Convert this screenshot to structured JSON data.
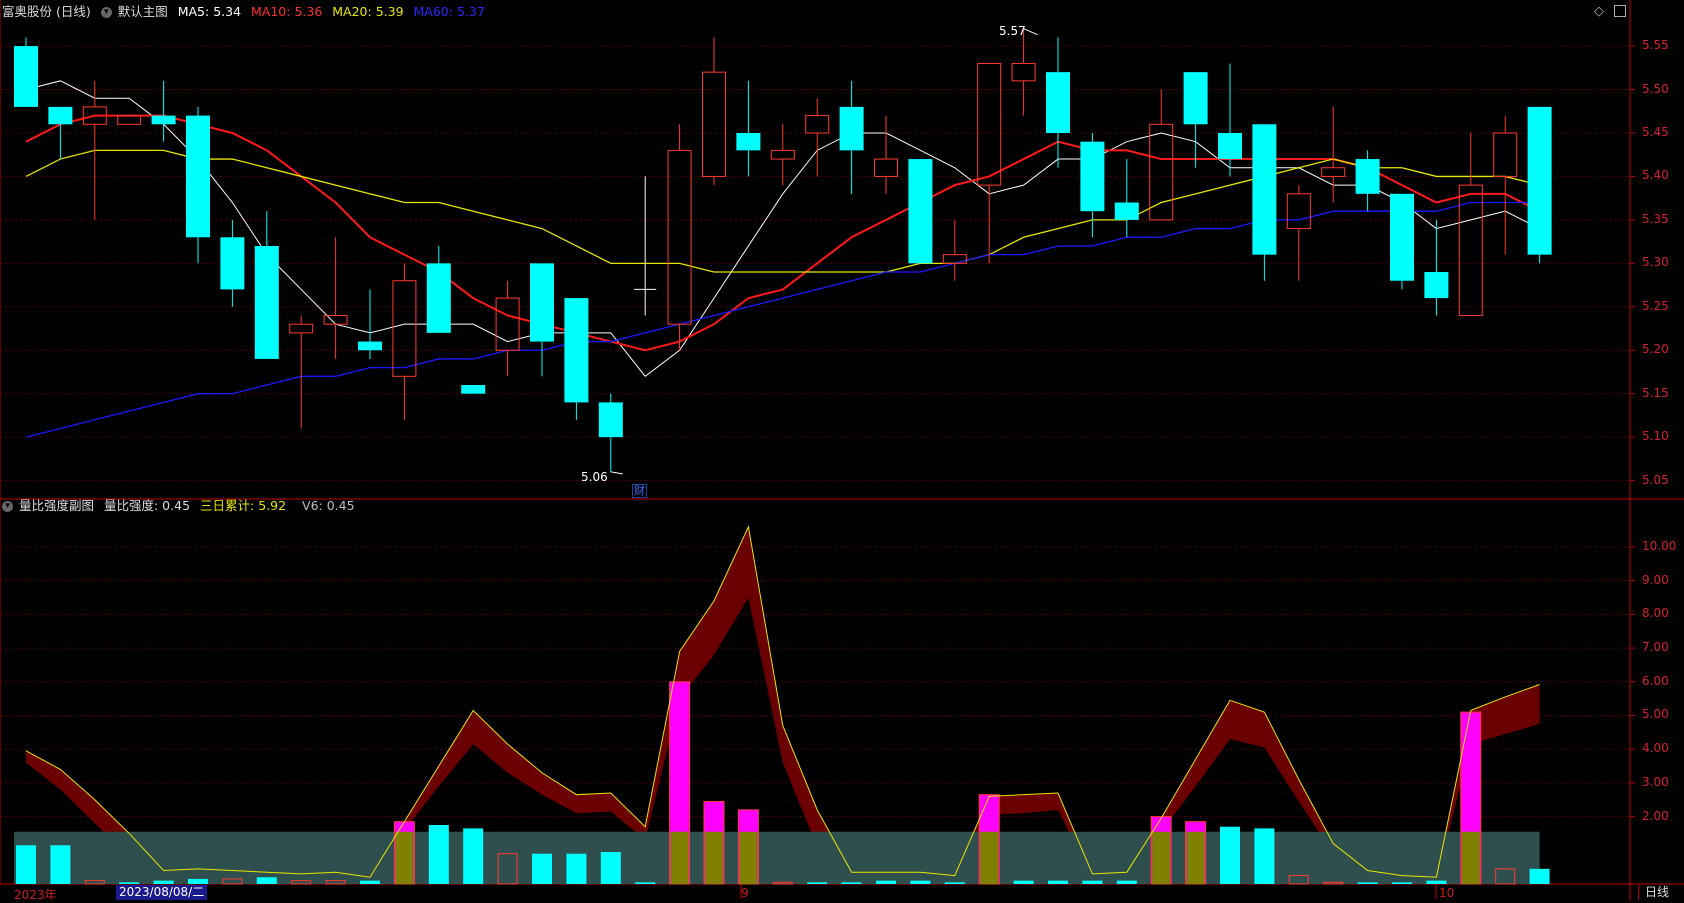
{
  "main_header": {
    "stock_name": "富奥股份 (日线)",
    "chart_name": "默认主图",
    "ma5": "MA5: 5.34",
    "ma10": "MA10: 5.36",
    "ma20": "MA20: 5.39",
    "ma60": "MA60: 5.37"
  },
  "sub_header": {
    "chart_name": "量比强度副图",
    "vr": "量比强度: 0.45",
    "sum3": "三日累计: 5.92",
    "v6": "V6: 0.45"
  },
  "icons": {
    "collapse": "chevron-down-icon",
    "restore": "diamond-icon",
    "close": "close-box-icon"
  },
  "bottom_bar": {
    "year": "2023年",
    "cursor_date": "2023/08/08/二",
    "month_9": "9",
    "month_10": "10",
    "period": "日线"
  },
  "annotations": {
    "high": "5.57",
    "low": "5.06",
    "finance_marker": "财"
  },
  "colors": {
    "up": "#ff3b30",
    "down": "#00ffff",
    "ma5": "#ffffff",
    "ma10": "#ff1a1a",
    "ma20": "#e6e600",
    "ma60": "#1a1aff",
    "axis": "#c00000",
    "band": "#2f4f4f",
    "ribbon": "#6b0000"
  },
  "chart_data": [
    {
      "type": "candlestick",
      "title": "默认主图",
      "yticks": [
        5.55,
        5.5,
        5.45,
        5.4,
        5.35,
        5.3,
        5.25,
        5.2,
        5.15,
        5.1,
        5.05
      ],
      "ylim": [
        5.03,
        5.58
      ],
      "candles": [
        {
          "o": 5.48,
          "c": 5.55,
          "h": 5.56,
          "l": 5.48,
          "d": "down"
        },
        {
          "o": 5.46,
          "c": 5.48,
          "h": 5.48,
          "l": 5.42,
          "d": "down"
        },
        {
          "o": 5.46,
          "c": 5.48,
          "h": 5.51,
          "l": 5.35,
          "d": "up"
        },
        {
          "o": 5.47,
          "c": 5.46,
          "h": 5.47,
          "l": 5.46,
          "d": "up"
        },
        {
          "o": 5.47,
          "c": 5.46,
          "h": 5.51,
          "l": 5.44,
          "d": "down"
        },
        {
          "o": 5.47,
          "c": 5.33,
          "h": 5.48,
          "l": 5.3,
          "d": "down"
        },
        {
          "o": 5.33,
          "c": 5.27,
          "h": 5.35,
          "l": 5.25,
          "d": "down"
        },
        {
          "o": 5.32,
          "c": 5.19,
          "h": 5.36,
          "l": 5.19,
          "d": "down"
        },
        {
          "o": 5.22,
          "c": 5.23,
          "h": 5.24,
          "l": 5.11,
          "d": "up"
        },
        {
          "o": 5.23,
          "c": 5.24,
          "h": 5.33,
          "l": 5.19,
          "d": "up"
        },
        {
          "o": 5.21,
          "c": 5.2,
          "h": 5.27,
          "l": 5.19,
          "d": "down"
        },
        {
          "o": 5.17,
          "c": 5.28,
          "h": 5.3,
          "l": 5.12,
          "d": "up"
        },
        {
          "o": 5.3,
          "c": 5.22,
          "h": 5.32,
          "l": 5.22,
          "d": "down"
        },
        {
          "o": 5.16,
          "c": 5.15,
          "h": 5.16,
          "l": 5.15,
          "d": "down"
        },
        {
          "o": 5.2,
          "c": 5.26,
          "h": 5.28,
          "l": 5.17,
          "d": "up"
        },
        {
          "o": 5.3,
          "c": 5.21,
          "h": 5.3,
          "l": 5.17,
          "d": "down"
        },
        {
          "o": 5.26,
          "c": 5.14,
          "h": 5.26,
          "l": 5.12,
          "d": "down"
        },
        {
          "o": 5.14,
          "c": 5.1,
          "h": 5.15,
          "l": 5.06,
          "d": "down"
        },
        {
          "o": 5.27,
          "c": 5.27,
          "h": 5.4,
          "l": 5.24,
          "d": "cross"
        },
        {
          "o": 5.23,
          "c": 5.43,
          "h": 5.46,
          "l": 5.2,
          "d": "up"
        },
        {
          "o": 5.4,
          "c": 5.52,
          "h": 5.56,
          "l": 5.39,
          "d": "up"
        },
        {
          "o": 5.45,
          "c": 5.43,
          "h": 5.51,
          "l": 5.4,
          "d": "down"
        },
        {
          "o": 5.42,
          "c": 5.43,
          "h": 5.46,
          "l": 5.39,
          "d": "up"
        },
        {
          "o": 5.45,
          "c": 5.47,
          "h": 5.49,
          "l": 5.4,
          "d": "up"
        },
        {
          "o": 5.48,
          "c": 5.43,
          "h": 5.51,
          "l": 5.38,
          "d": "down"
        },
        {
          "o": 5.4,
          "c": 5.42,
          "h": 5.47,
          "l": 5.38,
          "d": "up"
        },
        {
          "o": 5.42,
          "c": 5.3,
          "h": 5.42,
          "l": 5.3,
          "d": "down"
        },
        {
          "o": 5.3,
          "c": 5.31,
          "h": 5.35,
          "l": 5.28,
          "d": "up"
        },
        {
          "o": 5.39,
          "c": 5.53,
          "h": 5.53,
          "l": 5.3,
          "d": "up"
        },
        {
          "o": 5.51,
          "c": 5.53,
          "h": 5.57,
          "l": 5.47,
          "d": "up"
        },
        {
          "o": 5.52,
          "c": 5.45,
          "h": 5.56,
          "l": 5.41,
          "d": "down"
        },
        {
          "o": 5.44,
          "c": 5.36,
          "h": 5.45,
          "l": 5.33,
          "d": "down"
        },
        {
          "o": 5.37,
          "c": 5.35,
          "h": 5.42,
          "l": 5.33,
          "d": "down"
        },
        {
          "o": 5.35,
          "c": 5.46,
          "h": 5.5,
          "l": 5.35,
          "d": "up"
        },
        {
          "o": 5.52,
          "c": 5.46,
          "h": 5.52,
          "l": 5.41,
          "d": "down"
        },
        {
          "o": 5.45,
          "c": 5.42,
          "h": 5.53,
          "l": 5.4,
          "d": "down"
        },
        {
          "o": 5.46,
          "c": 5.31,
          "h": 5.46,
          "l": 5.28,
          "d": "down"
        },
        {
          "o": 5.34,
          "c": 5.38,
          "h": 5.39,
          "l": 5.28,
          "d": "up"
        },
        {
          "o": 5.4,
          "c": 5.41,
          "h": 5.48,
          "l": 5.37,
          "d": "up"
        },
        {
          "o": 5.42,
          "c": 5.38,
          "h": 5.43,
          "l": 5.36,
          "d": "down"
        },
        {
          "o": 5.38,
          "c": 5.28,
          "h": 5.38,
          "l": 5.27,
          "d": "down"
        },
        {
          "o": 5.29,
          "c": 5.26,
          "h": 5.35,
          "l": 5.24,
          "d": "down"
        },
        {
          "o": 5.24,
          "c": 5.39,
          "h": 5.45,
          "l": 5.24,
          "d": "up"
        },
        {
          "o": 5.4,
          "c": 5.45,
          "h": 5.47,
          "l": 5.31,
          "d": "up"
        },
        {
          "o": 5.48,
          "c": 5.31,
          "h": 5.48,
          "l": 5.3,
          "d": "down"
        }
      ],
      "series": [
        {
          "name": "MA5",
          "values": [
            5.5,
            5.51,
            5.49,
            5.49,
            5.46,
            5.42,
            5.37,
            5.31,
            5.27,
            5.23,
            5.22,
            5.23,
            5.23,
            5.23,
            5.21,
            5.22,
            5.22,
            5.22,
            5.17,
            5.2,
            5.26,
            5.32,
            5.38,
            5.43,
            5.45,
            5.45,
            5.43,
            5.41,
            5.38,
            5.39,
            5.42,
            5.42,
            5.44,
            5.45,
            5.44,
            5.41,
            5.41,
            5.41,
            5.39,
            5.39,
            5.37,
            5.34,
            5.35,
            5.36,
            5.34
          ]
        },
        {
          "name": "MA10",
          "values": [
            5.44,
            5.46,
            5.47,
            5.47,
            5.47,
            5.46,
            5.45,
            5.43,
            5.4,
            5.37,
            5.33,
            5.31,
            5.29,
            5.26,
            5.24,
            5.23,
            5.22,
            5.21,
            5.2,
            5.21,
            5.23,
            5.26,
            5.27,
            5.3,
            5.33,
            5.35,
            5.37,
            5.39,
            5.4,
            5.42,
            5.44,
            5.43,
            5.43,
            5.42,
            5.42,
            5.42,
            5.42,
            5.42,
            5.42,
            5.41,
            5.39,
            5.37,
            5.38,
            5.38,
            5.36
          ]
        },
        {
          "name": "MA20",
          "values": [
            5.4,
            5.42,
            5.43,
            5.43,
            5.43,
            5.42,
            5.42,
            5.41,
            5.4,
            5.39,
            5.38,
            5.37,
            5.37,
            5.36,
            5.35,
            5.34,
            5.32,
            5.3,
            5.3,
            5.3,
            5.29,
            5.29,
            5.29,
            5.29,
            5.29,
            5.29,
            5.3,
            5.3,
            5.31,
            5.33,
            5.34,
            5.35,
            5.35,
            5.37,
            5.38,
            5.39,
            5.4,
            5.41,
            5.42,
            5.41,
            5.41,
            5.4,
            5.4,
            5.4,
            5.39
          ]
        },
        {
          "name": "MA60",
          "values": [
            5.1,
            5.11,
            5.12,
            5.13,
            5.14,
            5.15,
            5.15,
            5.16,
            5.17,
            5.17,
            5.18,
            5.18,
            5.19,
            5.19,
            5.2,
            5.2,
            5.21,
            5.21,
            5.22,
            5.23,
            5.24,
            5.25,
            5.26,
            5.27,
            5.28,
            5.29,
            5.29,
            5.3,
            5.31,
            5.31,
            5.32,
            5.32,
            5.33,
            5.33,
            5.34,
            5.34,
            5.35,
            5.35,
            5.36,
            5.36,
            5.36,
            5.36,
            5.37,
            5.37,
            5.37
          ]
        }
      ]
    },
    {
      "type": "bar",
      "title": "量比强度副图",
      "yticks": [
        10.0,
        9.0,
        8.0,
        7.0,
        6.0,
        5.0,
        4.0,
        3.0,
        2.0
      ],
      "ylim": [
        0,
        10.8
      ],
      "band_level": 1.55,
      "series": [
        {
          "name": "量比强度",
          "values": [
            1.15,
            1.15,
            0.1,
            0.05,
            0.1,
            0.15,
            0.15,
            0.2,
            0.1,
            0.1,
            0.1,
            1.85,
            1.75,
            1.65,
            0.9,
            0.9,
            0.9,
            0.95,
            0.05,
            6.0,
            2.45,
            2.2,
            0.05,
            0.05,
            0.05,
            0.1,
            0.1,
            0.05,
            2.65,
            0.1,
            0.1,
            0.1,
            0.1,
            2.0,
            1.85,
            1.7,
            1.65,
            0.25,
            0.05,
            0.05,
            0.05,
            0.1,
            5.1,
            0.45,
            0.45
          ],
          "up": [
            false,
            false,
            true,
            false,
            false,
            false,
            true,
            false,
            true,
            true,
            false,
            true,
            false,
            false,
            true,
            false,
            false,
            false,
            false,
            true,
            true,
            false,
            true,
            false,
            false,
            false,
            false,
            false,
            true,
            false,
            false,
            false,
            false,
            true,
            false,
            false,
            false,
            true,
            true,
            false,
            false,
            false,
            true,
            true,
            false
          ]
        },
        {
          "name": "三日累计",
          "values": [
            3.95,
            3.4,
            2.5,
            1.5,
            0.4,
            0.45,
            0.4,
            0.35,
            0.3,
            0.35,
            0.2,
            1.85,
            3.5,
            5.15,
            4.15,
            3.3,
            2.65,
            2.7,
            1.7,
            6.9,
            8.4,
            10.6,
            4.7,
            2.2,
            0.35,
            0.35,
            0.35,
            0.25,
            2.6,
            2.65,
            2.7,
            0.3,
            0.35,
            1.95,
            3.7,
            5.45,
            5.1,
            3.1,
            1.2,
            0.4,
            0.25,
            0.2,
            5.15,
            5.55,
            5.92
          ]
        },
        {
          "name": "V6",
          "values": [
            3.6,
            2.8,
            1.8,
            0.8,
            0.35,
            0.35,
            0.35,
            0.3,
            0.25,
            0.25,
            0.15,
            1.6,
            2.9,
            4.15,
            3.3,
            2.65,
            2.1,
            2.15,
            1.3,
            5.5,
            6.8,
            8.5,
            3.6,
            1.1,
            0.15,
            0.15,
            0.15,
            0.1,
            2.05,
            2.1,
            2.2,
            0.15,
            0.2,
            1.55,
            2.9,
            4.3,
            4.05,
            2.45,
            0.9,
            0.25,
            0.15,
            0.1,
            4.15,
            4.45,
            4.75
          ]
        }
      ]
    }
  ]
}
